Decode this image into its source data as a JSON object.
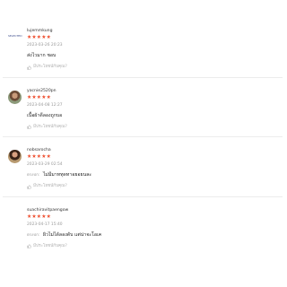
{
  "reviews": [
    {
      "username": "lujemmkung",
      "stars": "★★★★★",
      "date": "2023-03-26 20:23",
      "prefix": "",
      "comment": "ส่งไวมาก ชอบ",
      "helpful": "มีประโยชน์กับคุณ?",
      "avatar_logo_text": "SELECTED"
    },
    {
      "username": "yacnie2520pn",
      "stars": "★★★★★",
      "date": "2023-04-08 12:27",
      "prefix": "",
      "comment": "เนื้อผ้าดีลองถูกบอ",
      "helpful": "มีประโยชน์กับคุณ?"
    },
    {
      "username": "nobsarocha",
      "stars": "★★★★★",
      "date": "2023-03-29 02:54",
      "prefix": "ตรงปก:",
      "comment": "ไม่มีมาททุดทาอยอยนละ",
      "helpful": "มีประโยชน์กับคุณ?"
    },
    {
      "username": "suachiravitpaengow",
      "stars": "★★★★★",
      "date": "2023-04-17 15:40",
      "prefix": "ตรงปก:",
      "comment": "ผิวไม่ได้ลองดับ แต่น่าจะโอเค",
      "helpful": "มีประโยชน์กับคุณ?"
    }
  ]
}
